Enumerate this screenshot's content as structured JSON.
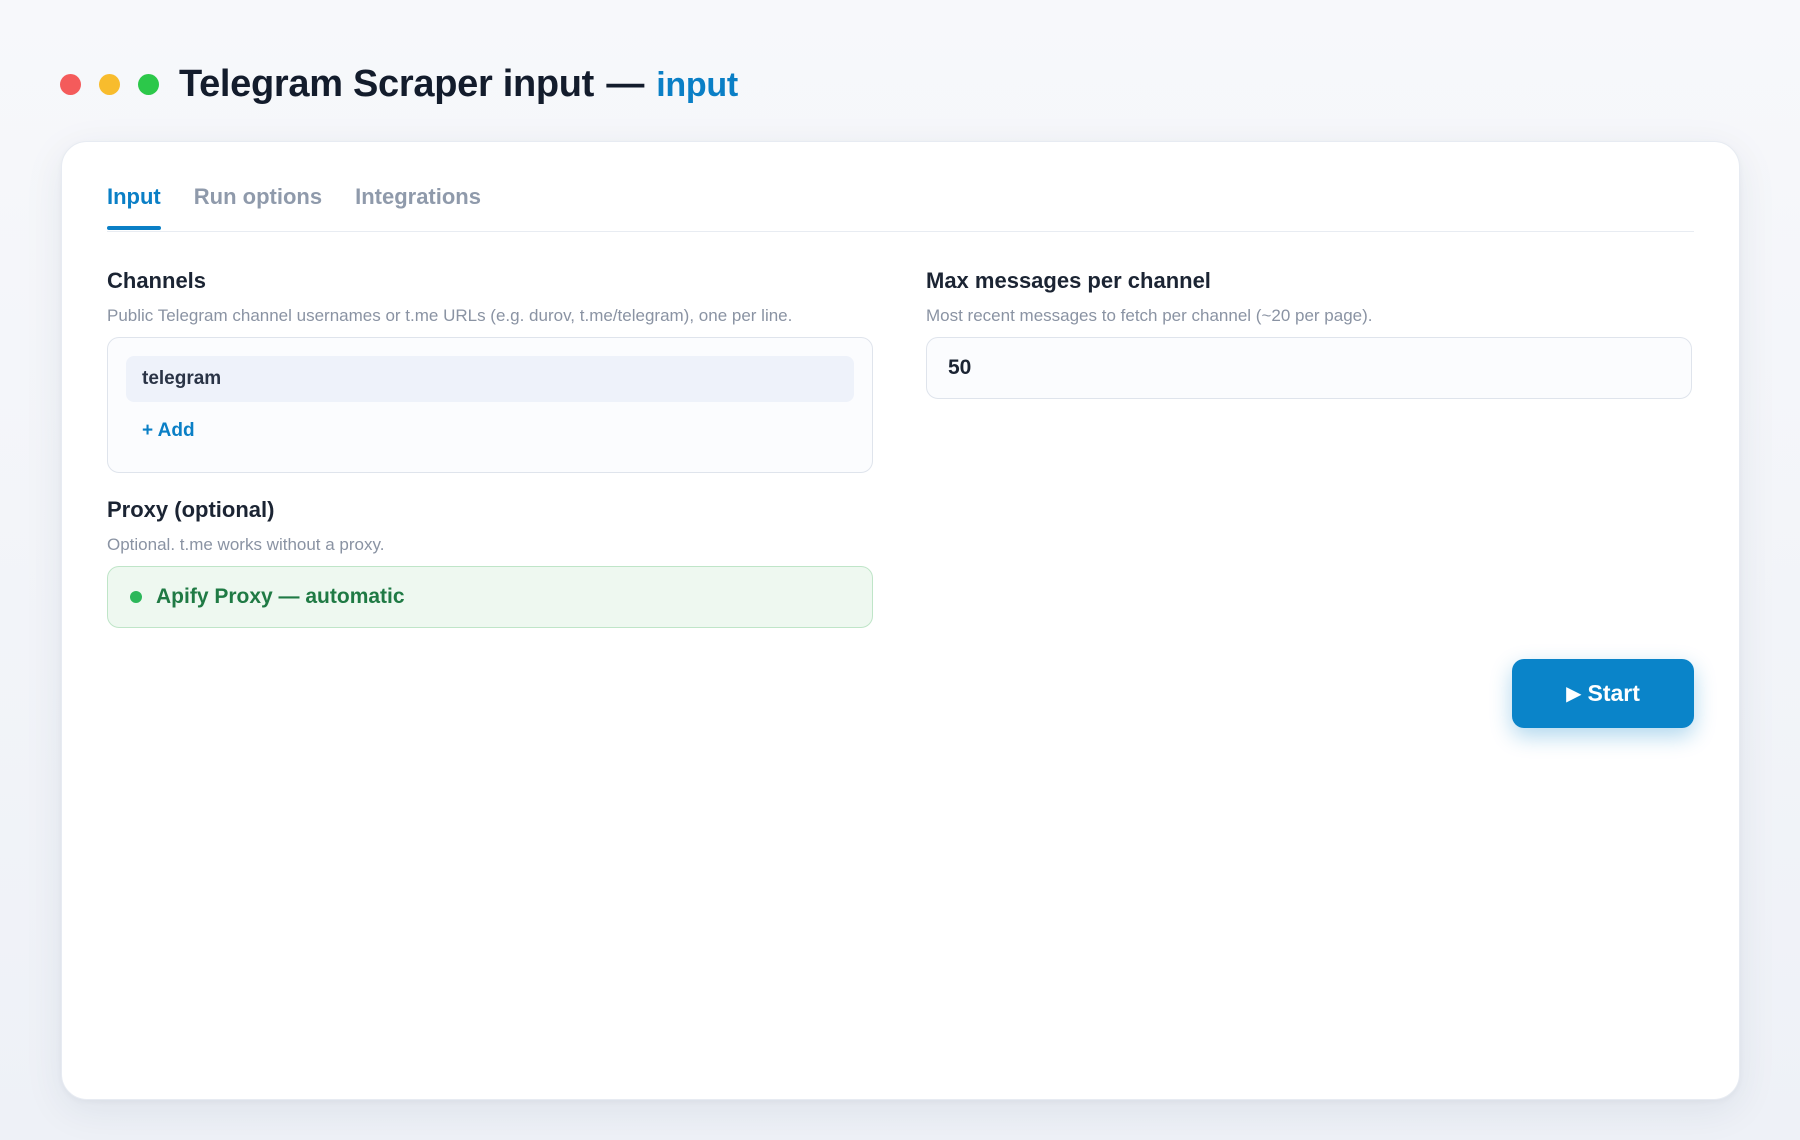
{
  "window": {
    "title": "Telegram Scraper input",
    "separator": "—",
    "subtitle": "input",
    "controls": [
      "close",
      "minimize",
      "maximize"
    ]
  },
  "tabs": [
    {
      "label": "Input",
      "active": true
    },
    {
      "label": "Run options",
      "active": false
    },
    {
      "label": "Integrations",
      "active": false
    }
  ],
  "channels": {
    "label": "Channels",
    "help": "Public Telegram channel usernames or t.me URLs (e.g. durov, t.me/telegram), one per line.",
    "items": [
      "telegram"
    ],
    "add_label": "+ Add"
  },
  "proxy": {
    "label": "Proxy (optional)",
    "help": "Optional. t.me works without a proxy.",
    "value": "Apify Proxy — automatic",
    "status_color": "#2cb75a"
  },
  "max_messages": {
    "label": "Max messages per channel",
    "help": "Most recent messages to fetch per channel (~20 per page).",
    "value": "50"
  },
  "start_button": {
    "icon": "play-icon",
    "label": "Start"
  },
  "colors": {
    "accent": "#0a7fc6",
    "close": "#f45b5b",
    "minimize": "#f8bc2d",
    "maximize": "#2cc84a"
  }
}
